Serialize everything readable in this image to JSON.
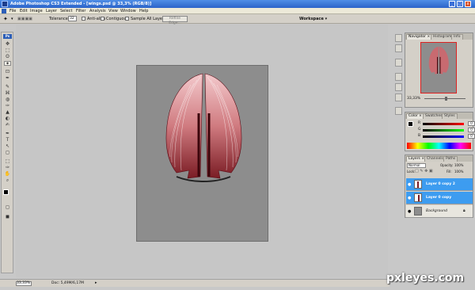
{
  "window": {
    "title": "Adobe Photoshop CS3 Extended - [wings.psd @ 33,3% (RGB/8)]",
    "minimize_glyph": "_",
    "maximize_glyph": "□",
    "close_glyph": "x"
  },
  "menu": [
    "File",
    "Edit",
    "Image",
    "Layer",
    "Select",
    "Filter",
    "Analysis",
    "View",
    "Window",
    "Help"
  ],
  "options": {
    "tolerance_label": "Tolerance:",
    "tolerance_value": "32",
    "anti_alias_label": "Anti-alias",
    "contiguous_label": "Contiguous",
    "sample_all_label": "Sample All Layers",
    "refine_edge_label": "Refine Edge...",
    "workspace_label": "Workspace ▾"
  },
  "tools": [
    "✥",
    "⬚",
    "ʘ",
    "✦",
    "⊡",
    "✒",
    "✎",
    "⌘",
    "◍",
    "✑",
    "▲",
    "◐",
    "✍",
    "T",
    "↖",
    "◻",
    "✋",
    "⌕",
    "◼"
  ],
  "status": {
    "zoom": "33,33%",
    "doc": "Doc: 5,49M/6,17M"
  },
  "navigator": {
    "tabs": [
      "Navigator ×",
      "Histogram",
      "Info"
    ],
    "zoom": "33,33%"
  },
  "color": {
    "tabs": [
      "Color ×",
      "Swatches",
      "Styles"
    ],
    "rows": [
      {
        "label": "R",
        "value": "0",
        "gradient": "linear-gradient(90deg,#000,#f00)"
      },
      {
        "label": "G",
        "value": "0",
        "gradient": "linear-gradient(90deg,#000,#0f0)"
      },
      {
        "label": "B",
        "value": "0",
        "gradient": "linear-gradient(90deg,#000,#00f)"
      }
    ]
  },
  "layers": {
    "tabs": [
      "Layers ×",
      "Channels",
      "Paths"
    ],
    "blend_mode": "Normal",
    "opacity_label": "Opacity:",
    "opacity_value": "100%",
    "lock_label": "Lock:",
    "fill_label": "Fill:",
    "fill_value": "100%",
    "items": [
      {
        "name": "Layer 0 copy 2",
        "selected": true
      },
      {
        "name": "Layer 0 copy",
        "selected": true
      },
      {
        "name": "Background",
        "selected": false
      }
    ]
  },
  "watermark": "pxleyes.com"
}
